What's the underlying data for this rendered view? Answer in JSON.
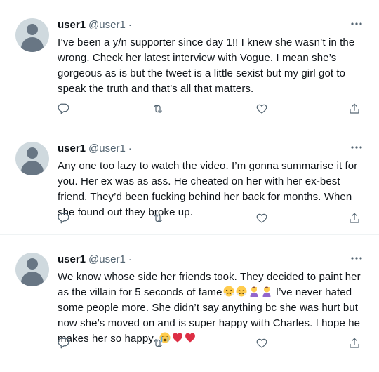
{
  "tweets": [
    {
      "name": "user1",
      "handle": "@user1",
      "separator": "·",
      "text": "I’ve been a y/n supporter since day 1!! I knew she wasn’t in the wrong. Check her latest interview with Vogue. I mean she’s gorgeous as is but the tweet is a little sexist but my girl got to speak the truth and that’s all that matters."
    },
    {
      "name": "user1",
      "handle": "@user1",
      "separator": "·",
      "text": "Any one too lazy to watch the video. I’m gonna summarise it for you. Her ex was as ass. He cheated on her with her ex-best friend. They’d been fucking behind her back for months. When she found out they broke up."
    },
    {
      "name": "user1",
      "handle": "@user1",
      "separator": "·",
      "text_part1": "We know whose side her friends took. They decided to paint her as the villain for 5 seconds of fame",
      "text_part2": " I’ve never hated some people more. She didn’t say anything bc she was hurt but now she’s moved on and is super happy with Charles. I hope he makes her so happy. ",
      "emoji_group1": [
        "steam-face-emoji",
        "steam-face-emoji",
        "person-facepalming-emoji",
        "person-facepalming-emoji"
      ],
      "emoji_group2": [
        "crying-face-emoji",
        "red-heart-emoji",
        "red-heart-emoji"
      ]
    }
  ],
  "colors": {
    "text": "#0f1419",
    "secondary": "#536471",
    "avatar_bg": "#cfd9de",
    "avatar_fg": "#687684",
    "divider": "#eff3f4",
    "heart": "#e0245e",
    "emoji_yellow": "#ffcc4d"
  },
  "icons": [
    "more-icon",
    "reply-icon",
    "retweet-icon",
    "like-icon",
    "share-icon"
  ]
}
